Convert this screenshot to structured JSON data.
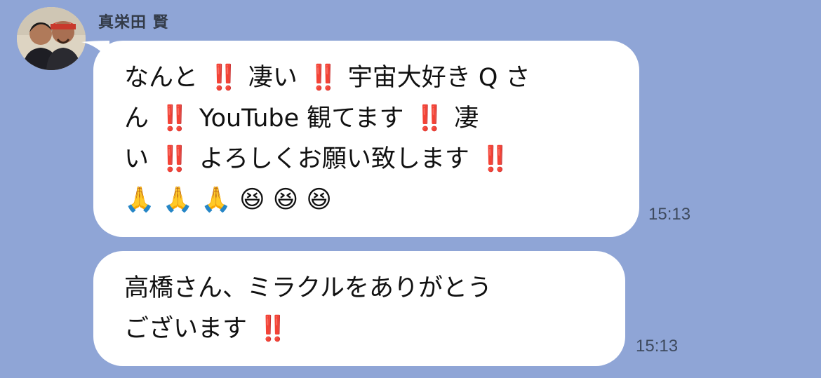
{
  "sender": {
    "name": "真栄田 賢"
  },
  "messages": [
    {
      "lines": [
        "なんと ‼️ 凄い ‼️ 宇宙大好き Q さ",
        "ん ‼️ YouTube 観てます ‼️ 凄",
        "い ‼️ よろしくお願い致します ‼️",
        "🙏 🙏 🙏 😆 😆 😆"
      ],
      "time": "15:13"
    },
    {
      "lines": [
        "高橋さん、ミラクルをありがとう",
        "ございます ‼️"
      ],
      "time": "15:13"
    }
  ],
  "colors": {
    "background": "#8fa5d6",
    "bubble": "#ffffff",
    "exclamation": "#e0242a"
  }
}
